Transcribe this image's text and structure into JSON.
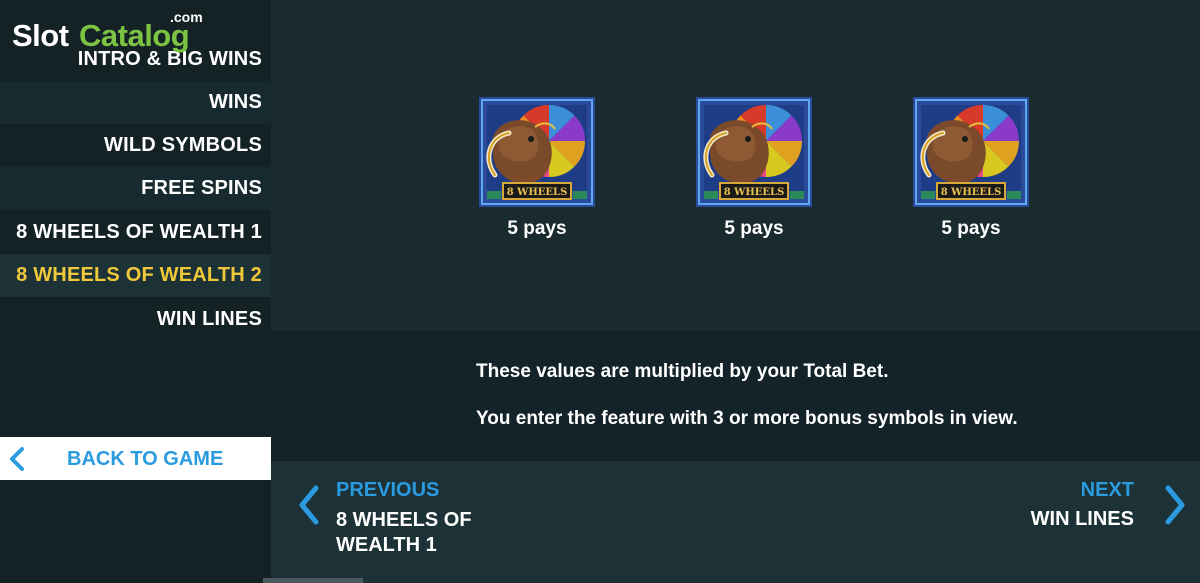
{
  "logo": {
    "part1": "Slot",
    "part2": "Catalog",
    "suffix": ".com"
  },
  "menu": {
    "items": [
      {
        "label": "INTRO & BIG WINS"
      },
      {
        "label": "WINS"
      },
      {
        "label": "WILD SYMBOLS"
      },
      {
        "label": "FREE SPINS"
      },
      {
        "label": "8 WHEELS OF WEALTH 1"
      },
      {
        "label": "8 WHEELS OF WEALTH 2",
        "active": true
      },
      {
        "label": "WIN LINES"
      }
    ],
    "back_label": "BACK TO GAME"
  },
  "symbols": [
    {
      "banner": "8 WHEELS",
      "pays": "5 pays"
    },
    {
      "banner": "8 WHEELS",
      "pays": "5 pays"
    },
    {
      "banner": "8 WHEELS",
      "pays": "5 pays"
    }
  ],
  "info": {
    "line1": "These values are multiplied by your Total Bet.",
    "line2": "You enter the feature with 3 or more bonus symbols in view."
  },
  "nav": {
    "previous_label": "PREVIOUS",
    "previous_target": "8 WHEELS OF WEALTH 1",
    "next_label": "NEXT",
    "next_target": "WIN LINES"
  },
  "colors": {
    "accent_blue": "#2b9be0",
    "active_yellow": "#f0c93a",
    "logo_green": "#7cc243"
  },
  "icons": [
    "chevron-left-icon",
    "chevron-right-icon",
    "elephant-wheel-symbol"
  ]
}
